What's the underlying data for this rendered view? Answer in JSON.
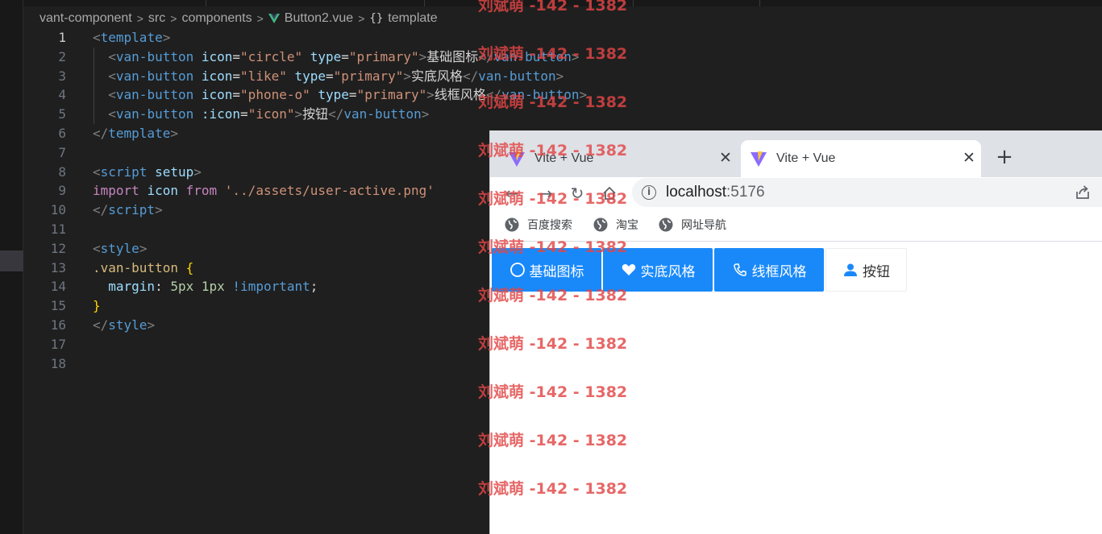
{
  "editor": {
    "breadcrumb": {
      "parts": [
        "vant-component",
        "src",
        "components"
      ],
      "file": "Button2.vue",
      "symbol": "template"
    },
    "active_line": 1,
    "lines": [
      {
        "n": "1",
        "tokens": [
          [
            "br",
            "<"
          ],
          [
            "tag",
            "template"
          ],
          [
            "br",
            ">"
          ]
        ]
      },
      {
        "n": "2",
        "tokens": [
          [
            "txt",
            "  "
          ],
          [
            "br",
            "<"
          ],
          [
            "tag",
            "van-button"
          ],
          [
            "txt",
            " "
          ],
          [
            "attr",
            "icon"
          ],
          [
            "punct",
            "="
          ],
          [
            "str",
            "\"circle\""
          ],
          [
            "txt",
            " "
          ],
          [
            "attr",
            "type"
          ],
          [
            "punct",
            "="
          ],
          [
            "str",
            "\"primary\""
          ],
          [
            "br",
            ">"
          ],
          [
            "zh",
            "基础图标"
          ],
          [
            "br",
            "</"
          ],
          [
            "tag",
            "van-button"
          ],
          [
            "br",
            ">"
          ]
        ]
      },
      {
        "n": "3",
        "tokens": [
          [
            "txt",
            "  "
          ],
          [
            "br",
            "<"
          ],
          [
            "tag",
            "van-button"
          ],
          [
            "txt",
            " "
          ],
          [
            "attr",
            "icon"
          ],
          [
            "punct",
            "="
          ],
          [
            "str",
            "\"like\""
          ],
          [
            "txt",
            " "
          ],
          [
            "attr",
            "type"
          ],
          [
            "punct",
            "="
          ],
          [
            "str",
            "\"primary\""
          ],
          [
            "br",
            ">"
          ],
          [
            "zh",
            "实底风格"
          ],
          [
            "br",
            "</"
          ],
          [
            "tag",
            "van-button"
          ],
          [
            "br",
            ">"
          ]
        ]
      },
      {
        "n": "4",
        "tokens": [
          [
            "txt",
            "  "
          ],
          [
            "br",
            "<"
          ],
          [
            "tag",
            "van-button"
          ],
          [
            "txt",
            " "
          ],
          [
            "attr",
            "icon"
          ],
          [
            "punct",
            "="
          ],
          [
            "str",
            "\"phone-o\""
          ],
          [
            "txt",
            " "
          ],
          [
            "attr",
            "type"
          ],
          [
            "punct",
            "="
          ],
          [
            "str",
            "\"primary\""
          ],
          [
            "br",
            ">"
          ],
          [
            "zh",
            "线框风格"
          ],
          [
            "br",
            "</"
          ],
          [
            "tag",
            "van-button"
          ],
          [
            "br",
            ">"
          ]
        ]
      },
      {
        "n": "5",
        "tokens": [
          [
            "txt",
            "  "
          ],
          [
            "br",
            "<"
          ],
          [
            "tag",
            "van-button"
          ],
          [
            "txt",
            " "
          ],
          [
            "attr",
            ":icon"
          ],
          [
            "punct",
            "="
          ],
          [
            "str",
            "\"icon\""
          ],
          [
            "br",
            ">"
          ],
          [
            "zh",
            "按钮"
          ],
          [
            "br",
            "</"
          ],
          [
            "tag",
            "van-button"
          ],
          [
            "br",
            ">"
          ]
        ]
      },
      {
        "n": "6",
        "tokens": [
          [
            "br",
            "</"
          ],
          [
            "tag",
            "template"
          ],
          [
            "br",
            ">"
          ]
        ]
      },
      {
        "n": "7",
        "tokens": []
      },
      {
        "n": "8",
        "tokens": [
          [
            "br",
            "<"
          ],
          [
            "tag",
            "script"
          ],
          [
            "txt",
            " "
          ],
          [
            "attr",
            "setup"
          ],
          [
            "br",
            ">"
          ]
        ]
      },
      {
        "n": "9",
        "tokens": [
          [
            "kw",
            "import"
          ],
          [
            "txt",
            " "
          ],
          [
            "var",
            "icon"
          ],
          [
            "txt",
            " "
          ],
          [
            "kw",
            "from"
          ],
          [
            "txt",
            " "
          ],
          [
            "str",
            "'../assets/user-active.png'"
          ]
        ]
      },
      {
        "n": "10",
        "tokens": [
          [
            "br",
            "</"
          ],
          [
            "tag",
            "script"
          ],
          [
            "br",
            ">"
          ]
        ]
      },
      {
        "n": "11",
        "tokens": []
      },
      {
        "n": "12",
        "tokens": [
          [
            "br",
            "<"
          ],
          [
            "tag",
            "style"
          ],
          [
            "br",
            ">"
          ]
        ]
      },
      {
        "n": "13",
        "tokens": [
          [
            "sel",
            ".van-button"
          ],
          [
            "txt",
            " "
          ],
          [
            "curly",
            "{"
          ]
        ]
      },
      {
        "n": "14",
        "tokens": [
          [
            "txt",
            "  "
          ],
          [
            "attr",
            "margin"
          ],
          [
            "punct",
            ": "
          ],
          [
            "num",
            "5px"
          ],
          [
            "txt",
            " "
          ],
          [
            "num",
            "1px"
          ],
          [
            "txt",
            " "
          ],
          [
            "imp",
            "!important"
          ],
          [
            "punct",
            ";"
          ]
        ]
      },
      {
        "n": "15",
        "tokens": [
          [
            "curly",
            "}"
          ]
        ]
      },
      {
        "n": "16",
        "tokens": [
          [
            "br",
            "</"
          ],
          [
            "tag",
            "style"
          ],
          [
            "br",
            ">"
          ]
        ]
      },
      {
        "n": "17",
        "tokens": []
      },
      {
        "n": "18",
        "tokens": []
      }
    ]
  },
  "browser": {
    "tabs": [
      {
        "title": "Vite + Vue",
        "active": false
      },
      {
        "title": "Vite + Vue",
        "active": true
      }
    ],
    "new_tab_label": "+",
    "tab_close_label": "✕",
    "url_host": "localhost",
    "url_port": ":5176",
    "info_label": "i",
    "nav": {
      "back": "←",
      "forward": "→",
      "reload": "↻"
    },
    "bookmarks": [
      "百度搜索",
      "淘宝",
      "网址导航"
    ],
    "buttons": [
      {
        "label": "基础图标",
        "icon": "circle-icon",
        "style": "primary"
      },
      {
        "label": "实底风格",
        "icon": "heart-icon",
        "style": "primary"
      },
      {
        "label": "线框风格",
        "icon": "phone-icon",
        "style": "primary"
      },
      {
        "label": "按钮",
        "icon": "user-icon",
        "style": "default"
      }
    ],
    "colors": {
      "primary": "#1989fa"
    }
  },
  "watermark": {
    "text": "刘斌萌 -142 - 1382",
    "count": 11
  }
}
